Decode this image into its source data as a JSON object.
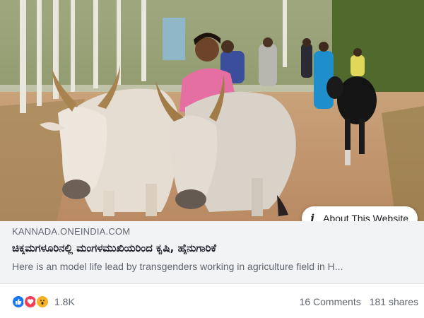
{
  "post": {
    "image_alt": "Two white oxen walking on a dirt road with people behind them",
    "about_label": "About This Website",
    "about_icon": "info-icon"
  },
  "link": {
    "domain": "KANNADA.ONEINDIA.COM",
    "headline": "ಚಿಕ್ಕಮಗಳೂರಿನಲ್ಲಿ ಮಂಗಳಮುಖಿಯರಿಂದ ಕೃಷಿ, ಹೈನುಗಾರಿಕೆ",
    "description": "Here is an model life lead by transgenders working in agriculture field in H..."
  },
  "footer": {
    "reaction_icons": [
      "like-icon",
      "love-icon",
      "wow-icon"
    ],
    "reaction_count": "1.8K",
    "comments": "16 Comments",
    "shares": "181 shares"
  },
  "colors": {
    "link_card_bg": "#f2f3f5",
    "like": "#1877f2",
    "love": "#f33e58",
    "wow": "#f7b125"
  }
}
